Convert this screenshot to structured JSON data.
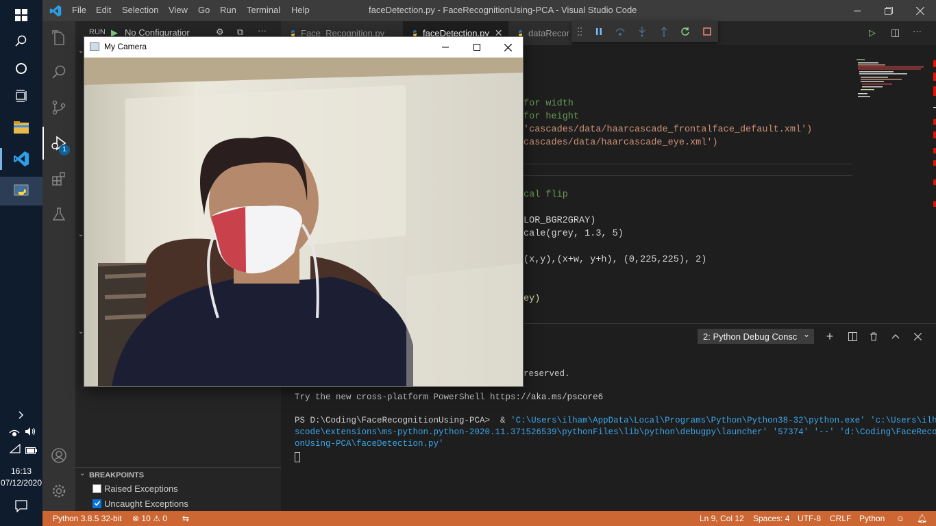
{
  "taskbar": {
    "clock_time": "16:13",
    "clock_date": "07/12/2020",
    "icons": [
      "windows-start-icon",
      "search-icon",
      "cortana-icon",
      "task-view-icon",
      "file-explorer-icon",
      "vscode-icon",
      "python-icon",
      "chevron-right-icon",
      "network-icon",
      "volume-icon",
      "wifi-icon",
      "battery-icon",
      "action-center-icon"
    ]
  },
  "titlebar": {
    "menus": [
      "File",
      "Edit",
      "Selection",
      "View",
      "Go",
      "Run",
      "Terminal",
      "Help"
    ],
    "title": "faceDetection.py - FaceRecognitionUsing-PCA - Visual Studio Code"
  },
  "activity": {
    "debug_badge": "1"
  },
  "sidebar": {
    "run_label": "RUN",
    "config": "No Configuratior",
    "breakpoints_title": "BREAKPOINTS",
    "breakpoints": [
      {
        "label": "Raised Exceptions",
        "checked": false
      },
      {
        "label": "Uncaught Exceptions",
        "checked": true
      }
    ]
  },
  "tabs": [
    {
      "label": "Face_Recognition.py",
      "active": false
    },
    {
      "label": "faceDetection.py",
      "active": true
    },
    {
      "label": "dataRecor",
      "active": false
    }
  ],
  "editor": {
    "lines": [
      {
        "text": "for width",
        "cls": "c-com"
      },
      {
        "text": "for height",
        "cls": "c-com"
      },
      {
        "text": "'cascades/data/haarcascade_frontalface_default.xml')",
        "cls": "c-str"
      },
      {
        "text": "cascades/data/haarcascade_eye.xml')",
        "cls": "c-str"
      },
      {
        "text": "cal flip",
        "cls": "c-com"
      },
      {
        "text": "LOR_BGR2GRAY)",
        "cls": "c-def"
      },
      {
        "text": "cale(grey, 1.3, 5)",
        "cls": "c-def"
      },
      {
        "text": "(x,y),(x+w, y+h), (0,225,225), 2)",
        "cls": "c-def"
      },
      {
        "text": "ey)",
        "cls": "c-fn"
      }
    ]
  },
  "panel": {
    "console_select": "2: Python Debug Consc",
    "terminal": {
      "reserved": "reserved.",
      "tip": "Try the new cross-platform PowerShell https://aka.ms/pscore6",
      "prompt": "PS D:\\Coding\\FaceRecognitionUsing-PCA>  & ",
      "cmd1": "'C:\\Users\\ilham\\AppData\\Local\\Programs\\Python\\Python38-32\\python.exe' 'c:\\Users\\ilham\\.v",
      "cmd2": "scode\\extensions\\ms-python.python-2020.11.371526539\\pythonFiles\\lib\\python\\debugpy\\launcher' '57374' '--' 'd:\\Coding\\FaceRecogniti",
      "cmd3": "onUsing-PCA\\faceDetection.py'"
    }
  },
  "statusbar": {
    "interpreter": "Python 3.8.5 32-bit",
    "errors": "10",
    "warnings": "0",
    "position": "Ln 9, Col 12",
    "spaces": "Spaces: 4",
    "encoding": "UTF-8",
    "eol": "CRLF",
    "language": "Python",
    "color": "#cc6633"
  },
  "camera_window": {
    "title": "My Camera"
  }
}
